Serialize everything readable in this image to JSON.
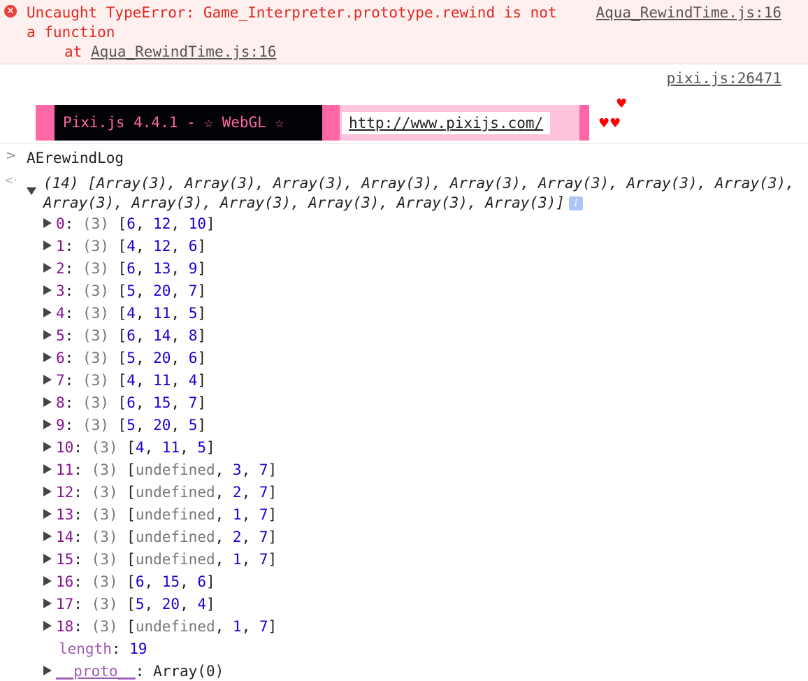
{
  "error": {
    "line1": "Uncaught TypeError: Game_Interpreter.prototype.rewind is not",
    "line2": "a function",
    "at_prefix": "at ",
    "source": "Aqua_RewindTime.js:16",
    "stack_source": "Aqua_RewindTime.js:16"
  },
  "pixi": {
    "source": "pixi.js:26471",
    "banner": "Pixi.js 4.4.1 - ☆ WebGL ☆",
    "url": "http://www.pixijs.com/",
    "heart_single": "♥",
    "heart_pair": "♥♥"
  },
  "input": {
    "prompt": ">",
    "command": "AErewindLog"
  },
  "result": {
    "return_marker": "<·",
    "summary_line1": "(14) [Array(3), Array(3), Array(3), Array(3), Array(3), Array(3), Array(3), Array",
    "summary_line2": "(3), Array(3), Array(3), Array(3), Array(3), Array(3), Array(3)]",
    "info": "i",
    "items": [
      {
        "index": "0",
        "count": "(3)",
        "values": [
          "6",
          "12",
          "10"
        ]
      },
      {
        "index": "1",
        "count": "(3)",
        "values": [
          "4",
          "12",
          "6"
        ]
      },
      {
        "index": "2",
        "count": "(3)",
        "values": [
          "6",
          "13",
          "9"
        ]
      },
      {
        "index": "3",
        "count": "(3)",
        "values": [
          "5",
          "20",
          "7"
        ]
      },
      {
        "index": "4",
        "count": "(3)",
        "values": [
          "4",
          "11",
          "5"
        ]
      },
      {
        "index": "5",
        "count": "(3)",
        "values": [
          "6",
          "14",
          "8"
        ]
      },
      {
        "index": "6",
        "count": "(3)",
        "values": [
          "5",
          "20",
          "6"
        ]
      },
      {
        "index": "7",
        "count": "(3)",
        "values": [
          "4",
          "11",
          "4"
        ]
      },
      {
        "index": "8",
        "count": "(3)",
        "values": [
          "6",
          "15",
          "7"
        ]
      },
      {
        "index": "9",
        "count": "(3)",
        "values": [
          "5",
          "20",
          "5"
        ]
      },
      {
        "index": "10",
        "count": "(3)",
        "values": [
          "4",
          "11",
          "5"
        ]
      },
      {
        "index": "11",
        "count": "(3)",
        "values": [
          "undefined",
          "3",
          "7"
        ]
      },
      {
        "index": "12",
        "count": "(3)",
        "values": [
          "undefined",
          "2",
          "7"
        ]
      },
      {
        "index": "13",
        "count": "(3)",
        "values": [
          "undefined",
          "1",
          "7"
        ]
      },
      {
        "index": "14",
        "count": "(3)",
        "values": [
          "undefined",
          "2",
          "7"
        ]
      },
      {
        "index": "15",
        "count": "(3)",
        "values": [
          "undefined",
          "1",
          "7"
        ]
      },
      {
        "index": "16",
        "count": "(3)",
        "values": [
          "6",
          "15",
          "6"
        ]
      },
      {
        "index": "17",
        "count": "(3)",
        "values": [
          "5",
          "20",
          "4"
        ]
      },
      {
        "index": "18",
        "count": "(3)",
        "values": [
          "undefined",
          "1",
          "7"
        ]
      }
    ],
    "length_key": "length",
    "length_value": "19",
    "proto_key": "__proto__",
    "proto_value": "Array(0)"
  }
}
